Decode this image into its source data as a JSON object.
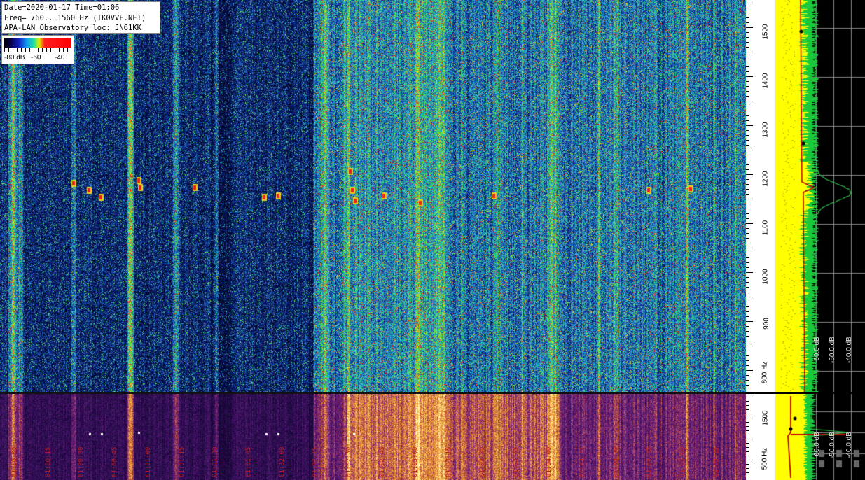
{
  "info_box": {
    "line1": "Date=2020-01-17 Time=01:06",
    "line2": "Freq= 760...1560 Hz (IK0VVE.NET)",
    "line3": "APA-LAN Observatory loc: JN61KK"
  },
  "color_scale": {
    "label_low": "-80 dB",
    "label_mid": "-60",
    "label_high": "-40"
  },
  "freq_axis": {
    "labels": [
      "1500",
      "1400",
      "1300",
      "1200",
      "1100",
      "1000",
      "900",
      "800 Hz"
    ]
  },
  "lower_freq_axis": {
    "labels": [
      "1500",
      "500 Hz"
    ]
  },
  "spectrum_axis": {
    "db_labels": [
      "-60.0 dB",
      "-50.0 dB",
      "-40.0 dB"
    ]
  },
  "lower_spectrum_axis": {
    "db_labels": [
      "-60.0 dB",
      "-50.0 dB",
      "-40.0 dB"
    ]
  },
  "time_labels": [
    "01:00:00",
    "01:00:15",
    "01:00:30",
    "01:00:45",
    "01:01:00",
    "01:01:15",
    "01:01:30",
    "01:01:45",
    "01:02:00",
    "01:02:15",
    "01:02:30",
    "01:02:45",
    "01:03:00",
    "01:03:15",
    "01:03:30",
    "01:03:45",
    "01:04:00",
    "01:04:15",
    "01:04:30",
    "01:04:45",
    "01:05:00",
    "01:05:15"
  ],
  "colors": {
    "waterfall_bg": "#061038",
    "spectrum_trace": "#ffff00",
    "avg_trace": "#19c93a",
    "peak_trace": "#c00000",
    "time_label": "#c01a1a"
  }
}
